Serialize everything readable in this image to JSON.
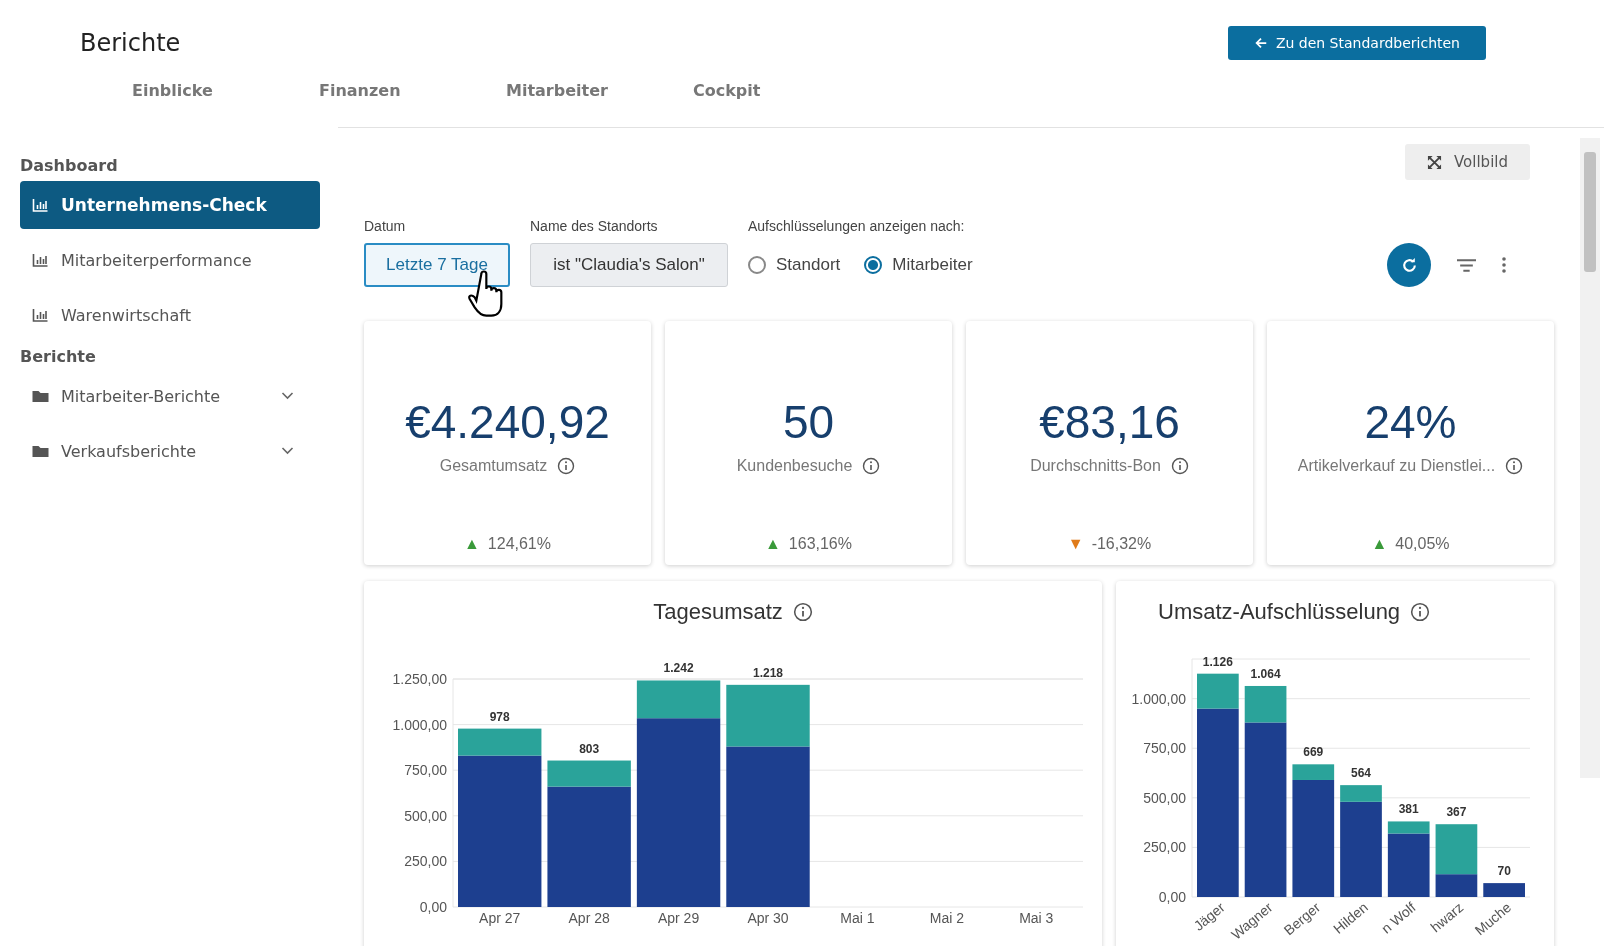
{
  "header": {
    "title": "Berichte",
    "back_button": "Zu den Standardberichten"
  },
  "tabs": [
    {
      "label": "Einblicke",
      "selected": false
    },
    {
      "label": "Finanzen",
      "selected": false
    },
    {
      "label": "Mitarbeiter",
      "selected": false
    },
    {
      "label": "Cockpit",
      "selected": false
    }
  ],
  "sidebar": {
    "sections": [
      {
        "title": "Dashboard",
        "items": [
          {
            "label": "Unternehmens-Check",
            "kind": "report",
            "selected": true
          },
          {
            "label": "Mitarbeiterperformance",
            "kind": "report",
            "selected": false
          },
          {
            "label": "Warenwirtschaft",
            "kind": "report",
            "selected": false
          }
        ]
      },
      {
        "title": "Berichte",
        "items": [
          {
            "label": "Mitarbeiter-Berichte",
            "kind": "folder",
            "selected": false,
            "expanded": false
          },
          {
            "label": "Verkaufsberichte",
            "kind": "folder",
            "selected": false,
            "expanded": false
          }
        ]
      }
    ]
  },
  "fullscreen_button": "Vollbild",
  "filters": {
    "date": {
      "label": "Datum",
      "value": "Letzte 7 Tage"
    },
    "location": {
      "label": "Name des Standorts",
      "value": "ist \"Claudia's Salon\""
    },
    "breakdown": {
      "label": "Aufschlüsselungen anzeigen nach:",
      "options": [
        {
          "label": "Standort",
          "selected": false
        },
        {
          "label": "Mitarbeiter",
          "selected": true
        }
      ]
    }
  },
  "kpis": [
    {
      "value": "€4.240,92",
      "label": "Gesamtumsatz",
      "arrow": "▲",
      "color": "#3a9a3a",
      "change": "124,61%"
    },
    {
      "value": "50",
      "label": "Kundenbesuche",
      "arrow": "▲",
      "color": "#3a9a3a",
      "change": "163,16%"
    },
    {
      "value": "€83,16",
      "label": "Durchschnitts-Bon",
      "arrow": "▼",
      "color": "#e07b1a",
      "change": "-16,32%"
    },
    {
      "value": "24%",
      "label": "Artikelverkauf zu Dienstlei...",
      "arrow": "▲",
      "color": "#3a9a3a",
      "change": "40,05%"
    }
  ],
  "charts": [
    {
      "title": "Tagesumsatz",
      "chart_data": {
        "type": "bar",
        "stacked": true,
        "grid": true,
        "ylim": [
          0,
          1250
        ],
        "categories": [
          "Apr 27",
          "Apr 28",
          "Apr 29",
          "Apr 30",
          "Mai 1",
          "Mai 2",
          "Mai 3"
        ],
        "yticks": [
          {
            "value": 0,
            "label": "0,00"
          },
          {
            "value": 250,
            "label": "250,00"
          },
          {
            "value": 500,
            "label": "500,00"
          },
          {
            "value": 750,
            "label": "750,00"
          },
          {
            "value": 1000,
            "label": "1.000,00"
          },
          {
            "value": 1250,
            "label": "1.250,00"
          }
        ],
        "series": [
          {
            "color": "#1d3f8f",
            "values": [
              830,
              660,
              1035,
              880,
              null,
              null,
              null
            ]
          },
          {
            "color": "#2aa39a",
            "values": [
              148,
              143,
              207,
              338,
              null,
              null,
              null
            ]
          }
        ],
        "value_labels": [
          "978",
          "803",
          "1.242",
          "1.218",
          null,
          null,
          null
        ]
      }
    },
    {
      "title": "Umsatz-Aufschlüsselung",
      "chart_data": {
        "type": "bar",
        "stacked": true,
        "grid": true,
        "ylim": [
          0,
          1200
        ],
        "categories": [
          "Jäger",
          "Wagner",
          "Berger",
          "Hilden",
          "n Wolf",
          "hwarz",
          "Muche"
        ],
        "yticks": [
          {
            "value": 0,
            "label": "0,00"
          },
          {
            "value": 250,
            "label": "250,00"
          },
          {
            "value": 500,
            "label": "500,00"
          },
          {
            "value": 750,
            "label": "750,00"
          },
          {
            "value": 1000,
            "label": "1.000,00"
          }
        ],
        "series": [
          {
            "color": "#1d3f8f",
            "values": [
              950,
              880,
              590,
              480,
              320,
              115,
              70
            ]
          },
          {
            "color": "#2aa39a",
            "values": [
              176,
              184,
              79,
              84,
              61,
              252,
              0
            ]
          }
        ],
        "value_labels": [
          "1.126",
          "1.064",
          "669",
          "564",
          "381",
          "367",
          "70"
        ]
      }
    }
  ]
}
